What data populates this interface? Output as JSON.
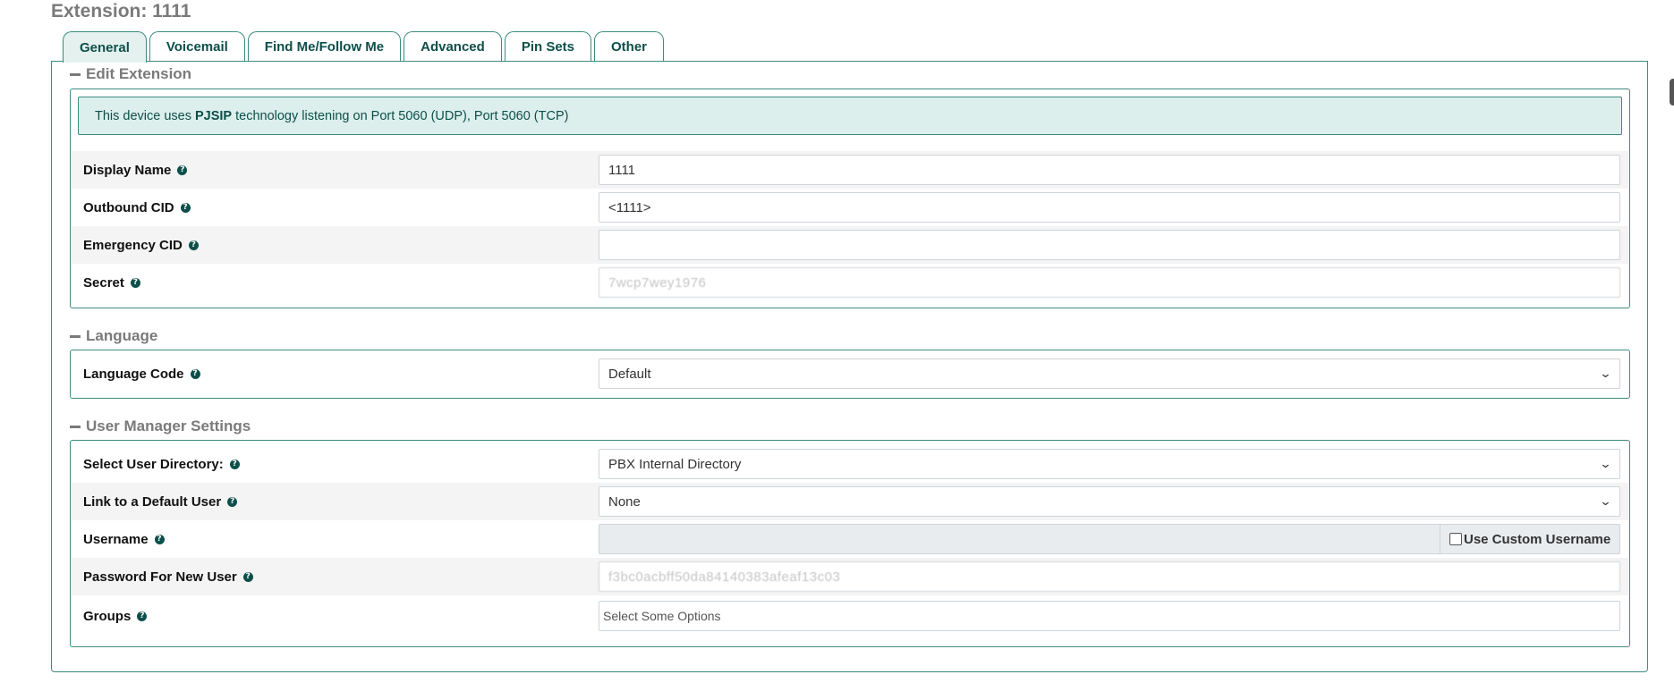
{
  "page": {
    "title": "Extension: 1111"
  },
  "tabs": [
    {
      "label": "General",
      "active": true
    },
    {
      "label": "Voicemail"
    },
    {
      "label": "Find Me/Follow Me"
    },
    {
      "label": "Advanced"
    },
    {
      "label": "Pin Sets"
    },
    {
      "label": "Other"
    }
  ],
  "edit_extension": {
    "heading": "Edit Extension",
    "alert": {
      "prefix": "This device uses",
      "tech": "PJSIP",
      "suffix": "technology listening on Port 5060 (UDP), Port 5060 (TCP)"
    },
    "display_name": {
      "label": "Display Name",
      "value": "1111"
    },
    "outbound_cid": {
      "label": "Outbound CID",
      "value": "<1111>"
    },
    "emergency_cid": {
      "label": "Emergency CID",
      "value": ""
    },
    "secret": {
      "label": "Secret",
      "value": "7wcp7wey1976"
    }
  },
  "language": {
    "heading": "Language",
    "language_code": {
      "label": "Language Code",
      "value": "Default"
    }
  },
  "user_manager": {
    "heading": "User Manager Settings",
    "directory": {
      "label": "Select User Directory:",
      "value": "PBX Internal Directory"
    },
    "default_user": {
      "label": "Link to a Default User",
      "value": "None"
    },
    "username": {
      "label": "Username",
      "value": "",
      "custom_label": "Use Custom Username",
      "custom_checked": false
    },
    "password": {
      "label": "Password For New User",
      "value": "f3bc0acbff50da84140383afeaf13c03"
    },
    "groups": {
      "label": "Groups",
      "placeholder": "Select Some Options"
    }
  },
  "colors": {
    "accent": "#3c8b80",
    "accent_dark": "#0d4f4a",
    "alert_bg": "#dcefec",
    "heading_grey": "#7a7a7a"
  },
  "icons": {
    "help": "question-circle-icon",
    "collapse": "minus-icon",
    "dropdown": "chevron-down-icon"
  }
}
